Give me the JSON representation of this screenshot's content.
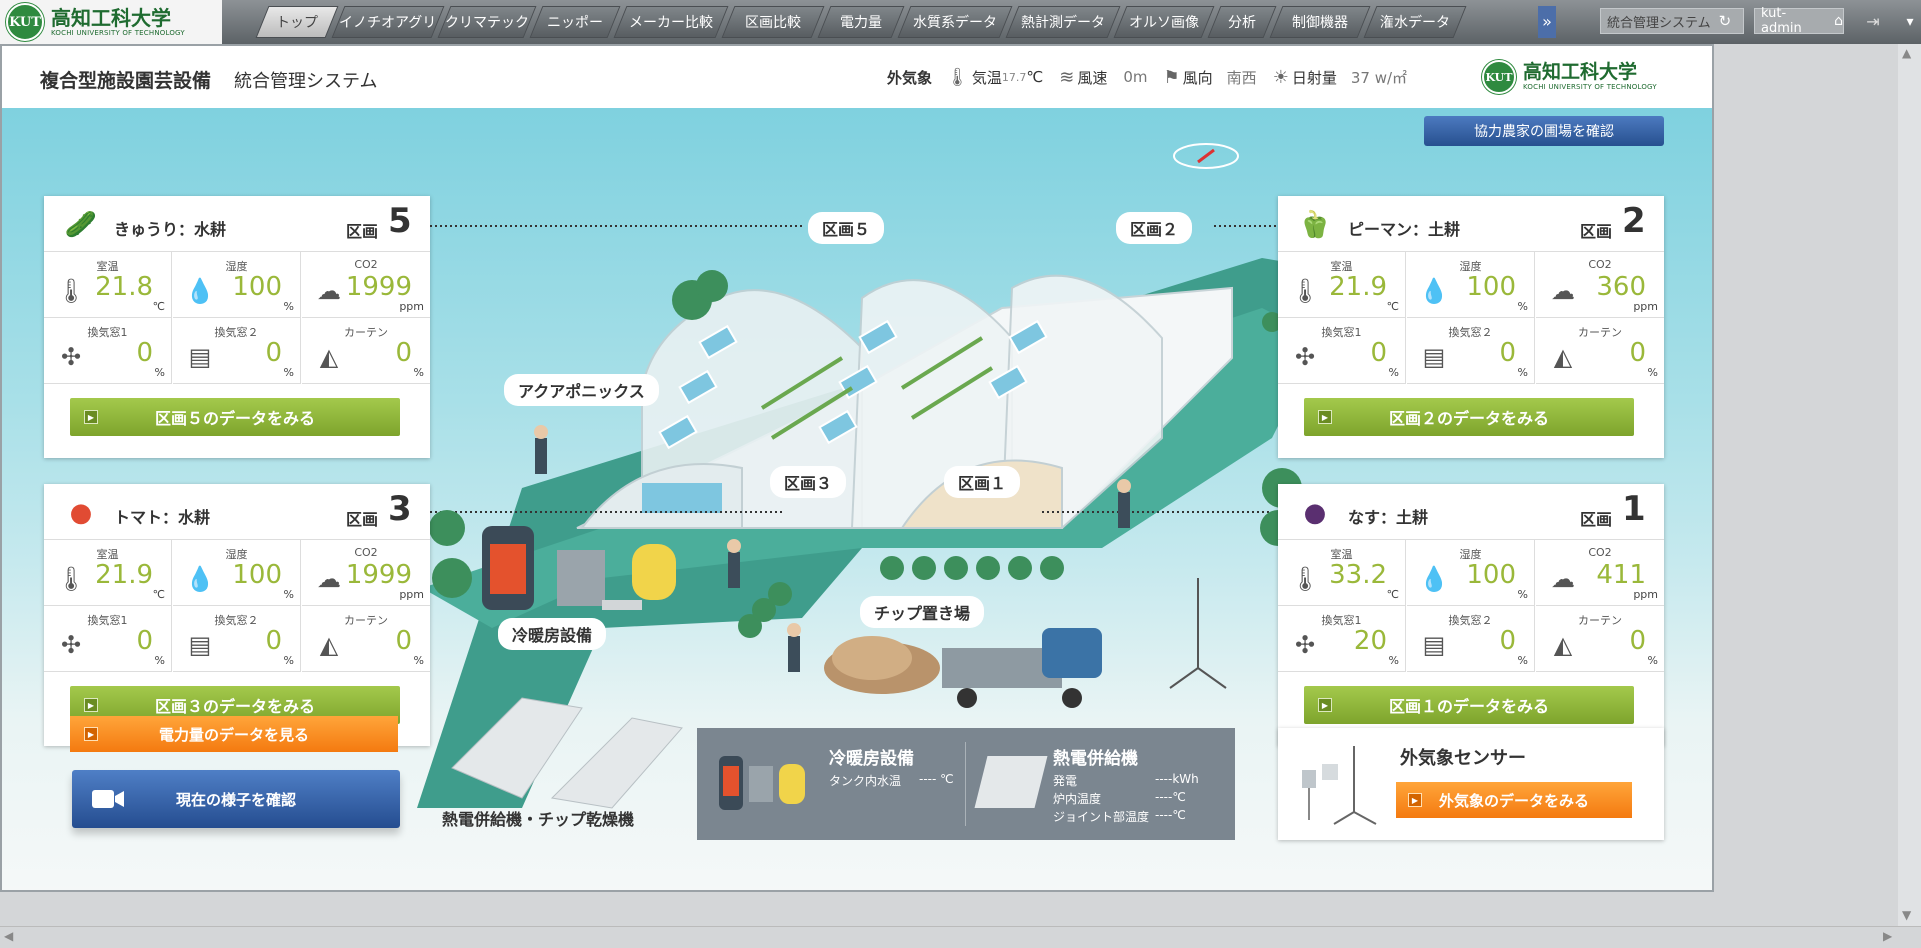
{
  "nav": {
    "logo": {
      "mark": "KUT",
      "name": "高知工科大学",
      "en": "KOCHI UNIVERSITY OF TECHNOLOGY"
    },
    "tabs": [
      "トップ",
      "イノチオアグリ",
      "クリマテック",
      "ニッポー",
      "メーカー比較",
      "区画比較",
      "電力量",
      "水質系データ",
      "熱計測データ",
      "オルソ画像",
      "分析",
      "制御機器",
      "潅水データ"
    ],
    "active_tab": 0,
    "more_icon": "chevron-double-down-icon",
    "system_label": "統合管理システム",
    "user_label": "kut-admin",
    "accent": "#4c6ea9"
  },
  "header": {
    "facility": "複合型施設園芸設備",
    "system": "統合管理システム",
    "weather": {
      "label": "外気象",
      "temp_label": "気温",
      "temp_value": "17.7",
      "temp_unit": "℃",
      "wind_label": "風速",
      "wind_value": "0m",
      "dir_label": "風向",
      "dir_value": "南西",
      "solar_label": "日射量",
      "solar_value": "37 w/㎡"
    }
  },
  "coop_button": "協力農家の圃場を確認",
  "plots": [
    {
      "crop": "きゅうり：水耕",
      "crop_icon": "cucumber-icon",
      "plot_word": "区画",
      "plot_no": "5",
      "room_temp_label": "室温",
      "room_temp": "21.8",
      "temp_unit": "℃",
      "humidity_label": "湿度",
      "humidity": "100",
      "hum_unit": "%",
      "co2_label": "CO2",
      "co2": "1999",
      "co2_unit": "ppm",
      "vent1_label": "換気窓1",
      "vent1": "0",
      "vent2_label": "換気窓２",
      "vent2": "0",
      "curtain_label": "カーテン",
      "curtain": "0",
      "pct": "%",
      "button": "区画５のデータをみる"
    },
    {
      "crop": "ピーマン：土耕",
      "crop_icon": "pepper-icon",
      "plot_word": "区画",
      "plot_no": "2",
      "room_temp_label": "室温",
      "room_temp": "21.9",
      "temp_unit": "℃",
      "humidity_label": "湿度",
      "humidity": "100",
      "hum_unit": "%",
      "co2_label": "CO2",
      "co2": "360",
      "co2_unit": "ppm",
      "vent1_label": "換気窓1",
      "vent1": "0",
      "vent2_label": "換気窓２",
      "vent2": "0",
      "curtain_label": "カーテン",
      "curtain": "0",
      "pct": "%",
      "button": "区画２のデータをみる"
    },
    {
      "crop": "トマト：水耕",
      "crop_icon": "tomato-icon",
      "plot_word": "区画",
      "plot_no": "3",
      "room_temp_label": "室温",
      "room_temp": "21.9",
      "temp_unit": "℃",
      "humidity_label": "湿度",
      "humidity": "100",
      "hum_unit": "%",
      "co2_label": "CO2",
      "co2": "1999",
      "co2_unit": "ppm",
      "vent1_label": "換気窓1",
      "vent1": "0",
      "vent2_label": "換気窓２",
      "vent2": "0",
      "curtain_label": "カーテン",
      "curtain": "0",
      "pct": "%",
      "button": "区画３のデータをみる"
    },
    {
      "crop": "なす：土耕",
      "crop_icon": "eggplant-icon",
      "plot_word": "区画",
      "plot_no": "1",
      "room_temp_label": "室温",
      "room_temp": "33.2",
      "temp_unit": "℃",
      "humidity_label": "湿度",
      "humidity": "100",
      "hum_unit": "%",
      "co2_label": "CO2",
      "co2": "411",
      "co2_unit": "ppm",
      "vent1_label": "換気窓1",
      "vent1": "20",
      "vent2_label": "換気窓２",
      "vent2": "0",
      "curtain_label": "カーテン",
      "curtain": "0",
      "pct": "%",
      "button": "区画１のデータをみる"
    }
  ],
  "scene": {
    "plot5": "区画５",
    "plot2": "区画２",
    "plot3": "区画３",
    "plot1": "区画１",
    "aquaponics": "アクアポニックス",
    "hvac": "冷暖房設備",
    "chip": "チップ置き場",
    "chp_dryer": "熱電併給機・チップ乾燥機"
  },
  "power_button": "電力量のデータを見る",
  "camera_button": "現在の様子を確認",
  "info": {
    "hvac_title": "冷暖房設備",
    "tank_label": "タンク内水温",
    "tank_value": "---- ℃",
    "chp_title": "熱電併給機",
    "gen_label": "発電",
    "gen_value": "----kWh",
    "furnace_label": "炉内温度",
    "furnace_value": "----℃",
    "joint_label": "ジョイント部温度",
    "joint_value": "----℃"
  },
  "weather_sensor": {
    "title": "外気象センサー",
    "button": "外気象のデータをみる"
  }
}
